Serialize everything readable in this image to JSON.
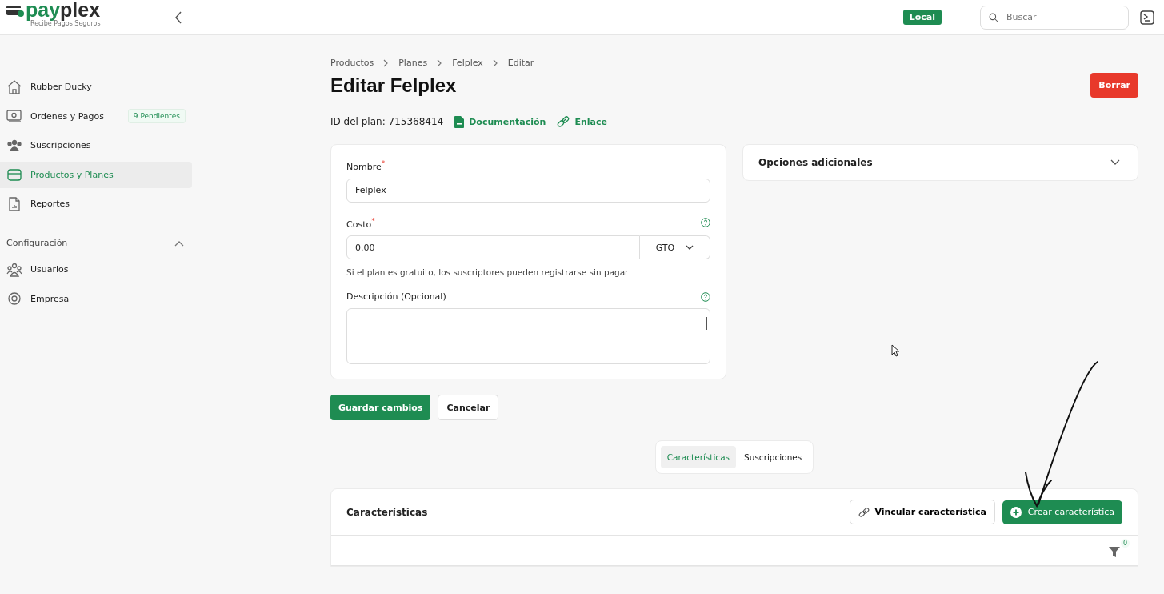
{
  "header": {
    "logo": {
      "accent": "pay",
      "rest": "plex",
      "tagline": "Recibe Pagos Seguros"
    },
    "environment_badge": "Local",
    "search": {
      "placeholder": "Buscar"
    }
  },
  "sidebar": {
    "items": [
      {
        "label": "Rubber Ducky",
        "selected": false
      },
      {
        "label": "Ordenes y Pagos",
        "badge": "9 Pendientes",
        "selected": false
      },
      {
        "label": "Suscripciones",
        "selected": false
      },
      {
        "label": "Productos y Planes",
        "selected": true
      },
      {
        "label": "Reportes",
        "selected": false
      }
    ],
    "section": {
      "title": "Configuración",
      "expanded": true,
      "items": [
        {
          "label": "Usuarios",
          "selected": false
        },
        {
          "label": "Empresa",
          "selected": false
        }
      ]
    }
  },
  "breadcrumb": [
    "Productos",
    "Planes",
    "Felplex",
    "Editar"
  ],
  "title": "Editar Felplex",
  "delete_button": "Borrar",
  "plan_id": "ID del plan: 715368414",
  "links": [
    "Documentación",
    "Enlace"
  ],
  "form": {
    "fields": [
      {
        "kind": "text",
        "label": "Nombre",
        "required_mark": "*",
        "help": false,
        "value": "Felplex"
      },
      {
        "kind": "currency",
        "label": "Costo",
        "required_mark": "*",
        "help": true,
        "value": "0.00",
        "currency": "GTQ",
        "hint": "Si el plan es gratuito, los suscriptores pueden registrarse sin pagar"
      },
      {
        "kind": "textarea",
        "label": "Descripción (Opcional)",
        "help": true
      }
    ]
  },
  "additional_options": {
    "title": "Opciones adicionales",
    "expanded": false
  },
  "actions": [
    "Guardar cambios",
    "Cancelar"
  ],
  "tabs": [
    {
      "label": "Características",
      "selected": true
    },
    {
      "label": "Suscripciones",
      "selected": false
    }
  ],
  "features_panel": {
    "title": "Características",
    "buttons": [
      "Vincular característica",
      "Crear característica"
    ],
    "filter_count": "0"
  }
}
